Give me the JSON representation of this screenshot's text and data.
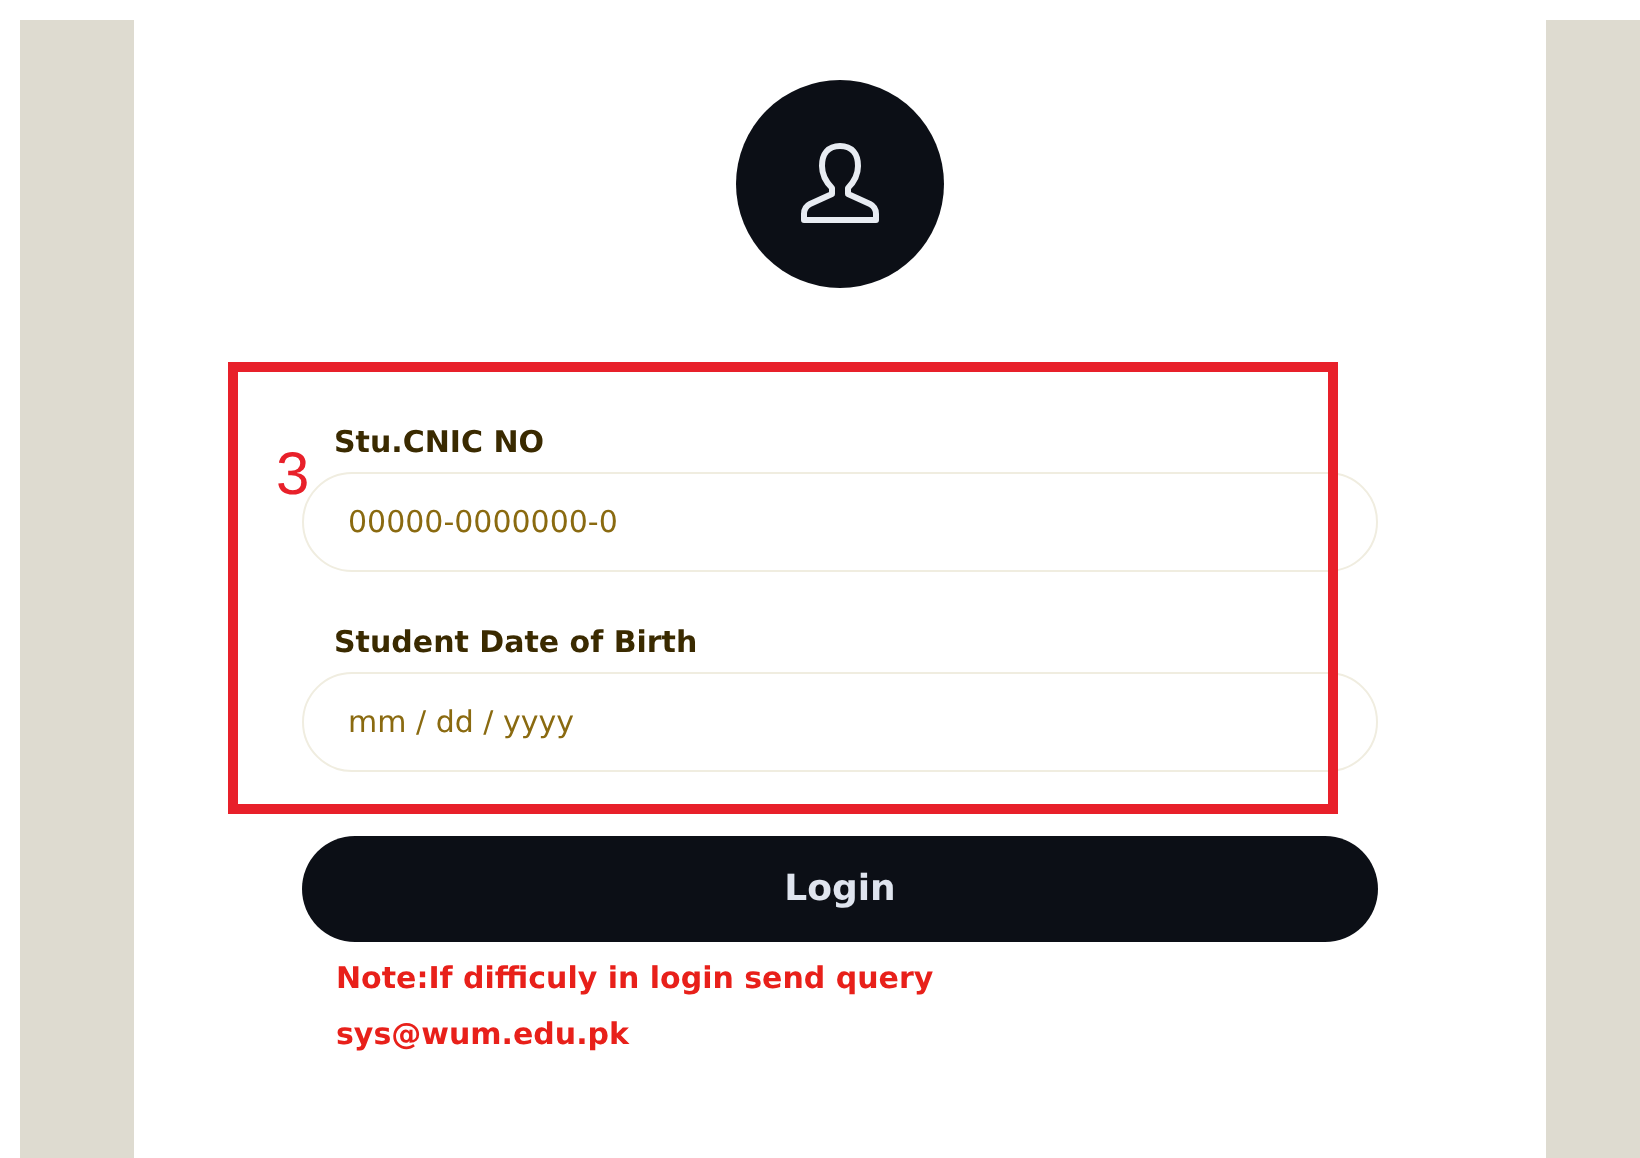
{
  "fields": [
    {
      "label": "Stu.CNIC NO",
      "placeholder": "00000-0000000-0"
    },
    {
      "label": "Student Date of Birth",
      "placeholder": "mm / dd / yyyy"
    }
  ],
  "login_button": "Login",
  "note_lines": [
    "Note:If difficuly in login send query",
    "sys@wum.edu.pk"
  ],
  "annotation": {
    "label": "3"
  }
}
